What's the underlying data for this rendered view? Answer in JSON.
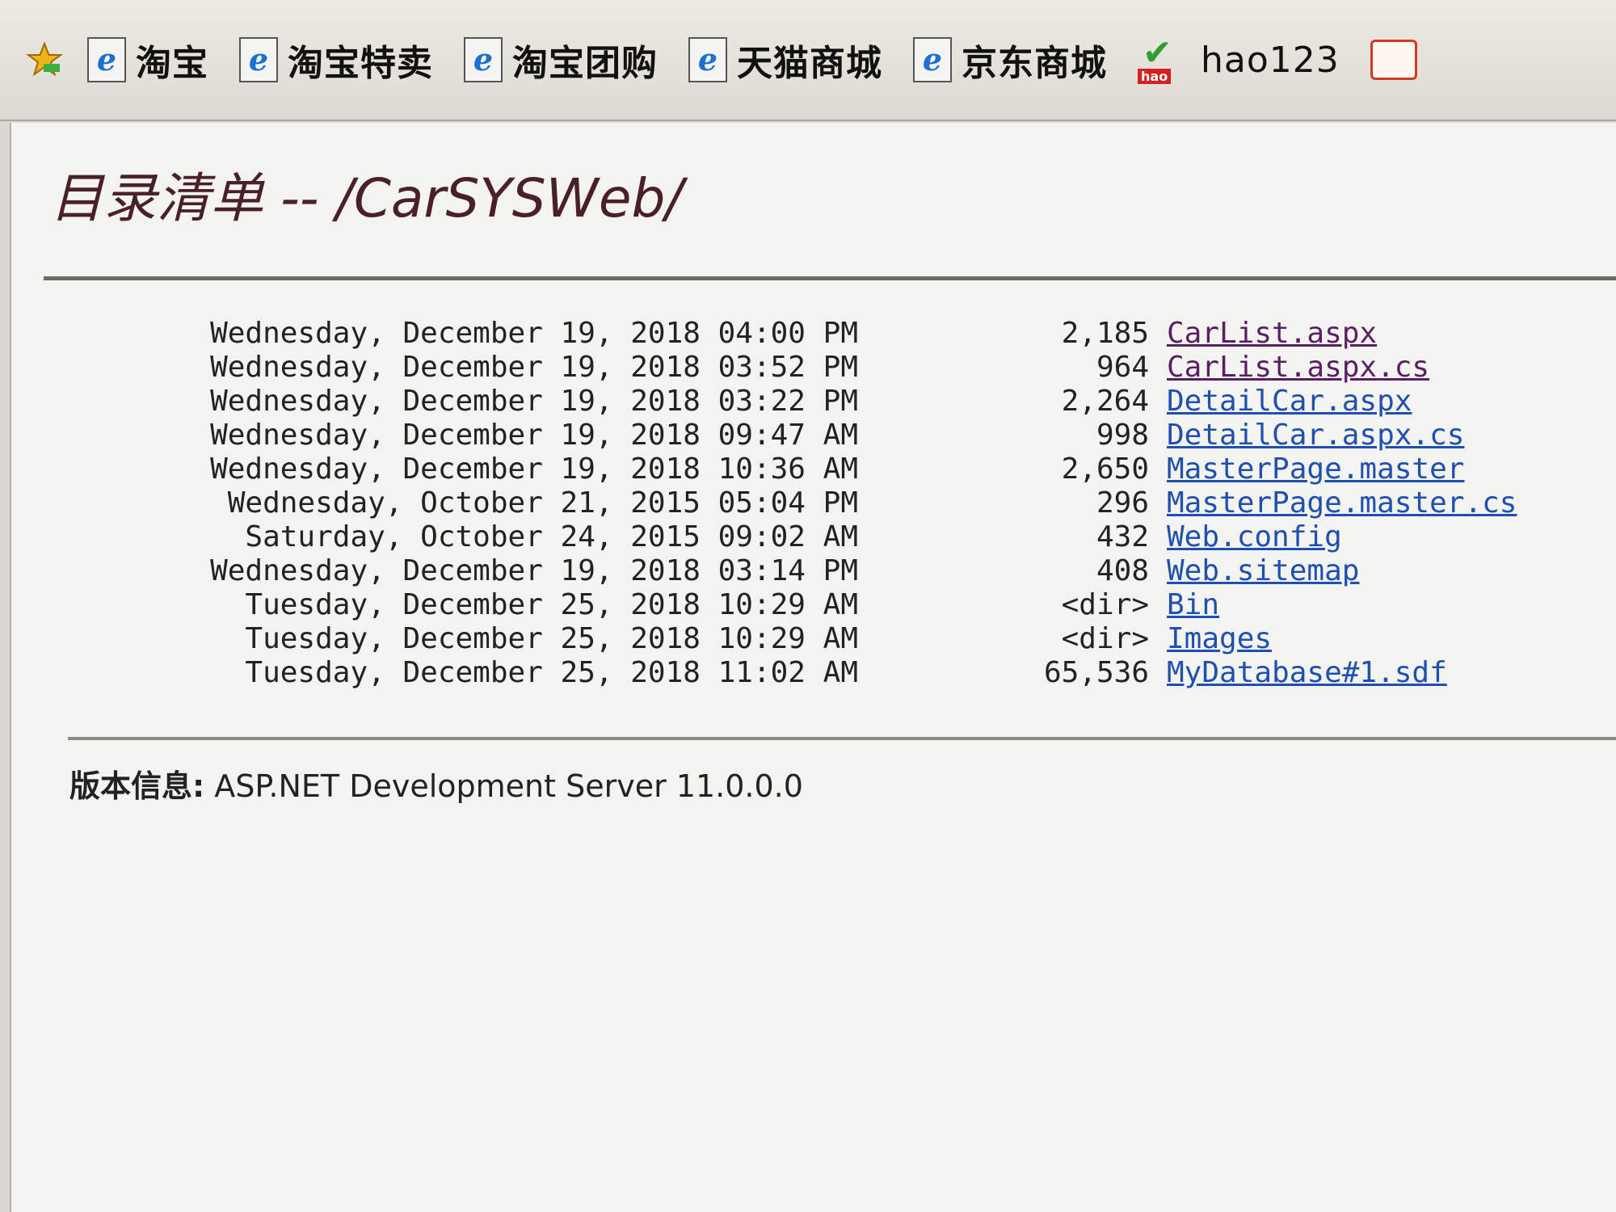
{
  "favorites_bar": {
    "items": [
      {
        "label": "淘宝",
        "icon": "ie-page-icon"
      },
      {
        "label": "淘宝特卖",
        "icon": "ie-page-icon"
      },
      {
        "label": "淘宝团购",
        "icon": "ie-page-icon"
      },
      {
        "label": "天猫商城",
        "icon": "ie-page-icon"
      },
      {
        "label": "京东商城",
        "icon": "ie-page-icon"
      },
      {
        "label": "hao123",
        "icon": "hao123-icon"
      }
    ],
    "hao_icon_text": "hao"
  },
  "page": {
    "title": "目录清单 -- /CarSYSWeb/",
    "entries": [
      {
        "date": "Wednesday, December 19, 2018 04:00 PM",
        "size": "2,185",
        "name": "CarList.aspx",
        "visited": true
      },
      {
        "date": "Wednesday, December 19, 2018 03:52 PM",
        "size": "964",
        "name": "CarList.aspx.cs",
        "visited": true
      },
      {
        "date": "Wednesday, December 19, 2018 03:22 PM",
        "size": "2,264",
        "name": "DetailCar.aspx",
        "visited": false
      },
      {
        "date": "Wednesday, December 19, 2018 09:47 AM",
        "size": "998",
        "name": "DetailCar.aspx.cs",
        "visited": false
      },
      {
        "date": "Wednesday, December 19, 2018 10:36 AM",
        "size": "2,650",
        "name": "MasterPage.master",
        "visited": false
      },
      {
        "date": "Wednesday, October 21, 2015 05:04 PM",
        "size": "296",
        "name": "MasterPage.master.cs",
        "visited": false
      },
      {
        "date": "Saturday, October 24, 2015 09:02 AM",
        "size": "432",
        "name": "Web.config",
        "visited": false
      },
      {
        "date": "Wednesday, December 19, 2018 03:14 PM",
        "size": "408",
        "name": "Web.sitemap",
        "visited": false
      },
      {
        "date": "Tuesday, December 25, 2018 10:29 AM",
        "size": "<dir>",
        "name": "Bin",
        "visited": false
      },
      {
        "date": "Tuesday, December 25, 2018 10:29 AM",
        "size": "<dir>",
        "name": "Images",
        "visited": false
      },
      {
        "date": "Tuesday, December 25, 2018 11:02 AM",
        "size": "65,536",
        "name": "MyDatabase#1.sdf",
        "visited": false
      }
    ],
    "version_label": "版本信息:",
    "version_value": " ASP.NET Development Server 11.0.0.0"
  },
  "colors": {
    "visited_link": "#5a1e63",
    "unvisited_link": "#1f4fb0",
    "title": "#4a2028"
  }
}
